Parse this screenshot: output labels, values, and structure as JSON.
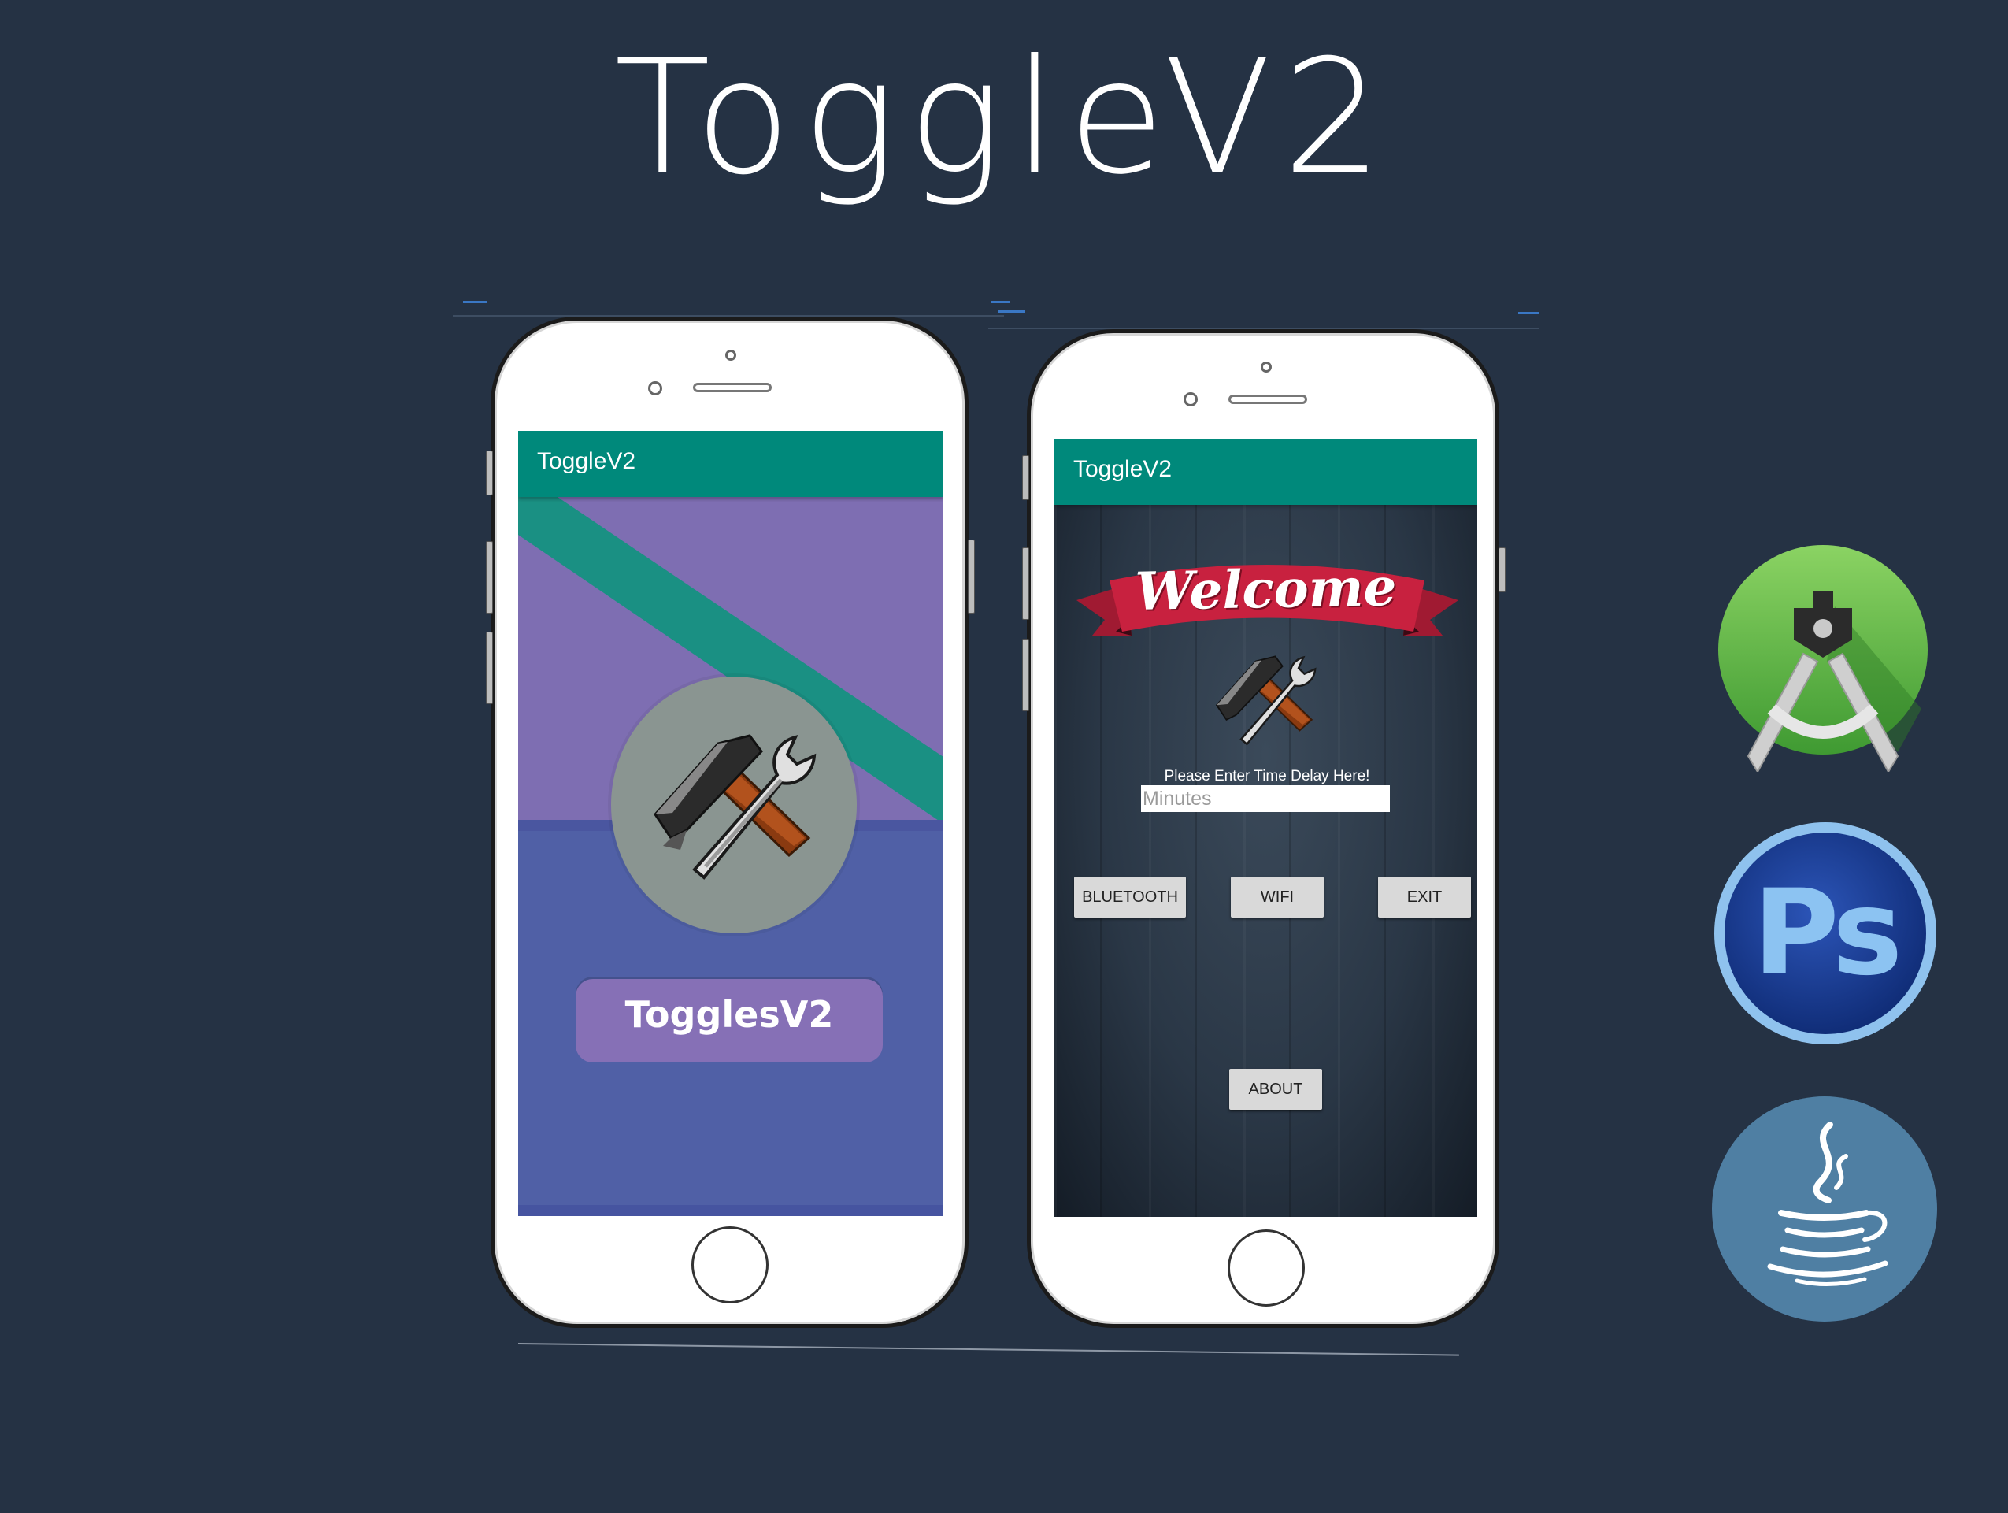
{
  "page": {
    "title": "ToggleV2",
    "background": "#253244"
  },
  "phone_left": {
    "appbar_title": "ToggleV2",
    "splash_button": "TogglesV2",
    "appbar_color": "#00897b",
    "logo_icon": "hammer-wrench-icon"
  },
  "phone_right": {
    "appbar_title": "ToggleV2",
    "banner_text": "Welcome",
    "logo_icon": "hammer-wrench-icon",
    "prompt": "Please Enter Time Delay Here!",
    "input_placeholder": "Minutes",
    "buttons": {
      "bluetooth": "BLUETOOTH",
      "wifi": "WIFI",
      "exit": "EXIT",
      "about": "ABOUT"
    }
  },
  "tech_icons": [
    "android-studio-icon",
    "photoshop-icon",
    "java-icon"
  ],
  "photoshop_label": "Ps"
}
